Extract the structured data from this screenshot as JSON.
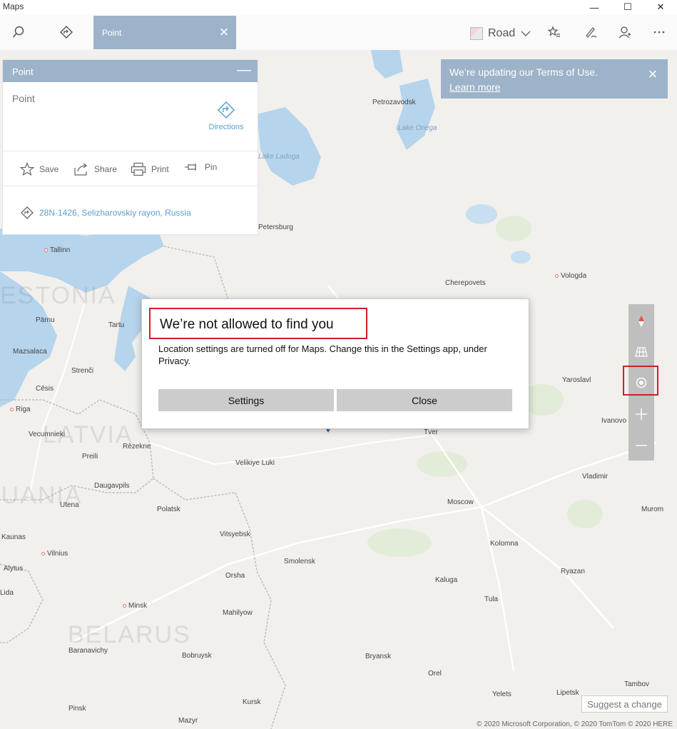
{
  "window": {
    "title": "Maps",
    "minimize": "—",
    "maximize": "☐",
    "close": "✕"
  },
  "toolbar": {
    "search_tab_label": "Point",
    "map_style": "Road"
  },
  "card": {
    "header": "Point",
    "minimize_glyph": "—",
    "name": "Point",
    "directions": "Directions",
    "actions": {
      "save": "Save",
      "share": "Share",
      "print": "Print",
      "pin": "Pin"
    },
    "address": "28N-1426, Selizharovskiy rayon, Russia"
  },
  "terms": {
    "text": "We’re updating our Terms of Use.",
    "link": "Learn more"
  },
  "dialog": {
    "title": "We’re not allowed to find you",
    "body": "Location settings are turned off for Maps. Change this in the Settings app, under Privacy.",
    "settings_button": "Settings",
    "close_button": "Close"
  },
  "footer": {
    "suggest": "Suggest a change",
    "copyright": "© 2020 Microsoft Corporation, © 2020 TomTom © 2020 HERE"
  },
  "map": {
    "cities": [
      "Petrozavodsk",
      "Lake Onega",
      "Lake Ladoga",
      "Petersburg",
      "Tallinn",
      "Cherepovets",
      "Vologda",
      "Tartu",
      "Pärnu",
      "Mazsalaca",
      "Strenči",
      "Cēsis",
      "Riga",
      "Vecumnieki",
      "Rēzekne",
      "Preili",
      "Daugavpils",
      "Utena",
      "Polatsk",
      "Velikiye Luki",
      "Vitsyebsk",
      "Kaunas",
      "Vilnius",
      "Alytus",
      "Orsha",
      "Smolensk",
      "Minsk",
      "Mahilyow",
      "Moscow",
      "Kolomna",
      "Kaluga",
      "Tula",
      "Ryazan",
      "Yaroslavl",
      "Ivanovo",
      "Vladimir",
      "Murom",
      "Tver",
      "Bryansk",
      "Orel",
      "Yelets",
      "Lipetsk",
      "Tambov",
      "Baranavichy",
      "Bobruysk",
      "Pinsk",
      "Mazyr",
      "Kursk",
      "Lida"
    ],
    "countries": [
      "ESTONIA",
      "LATVIA",
      "LITHUANIA",
      "BELARUS"
    ]
  },
  "colors": {
    "accent": "#9db3c9",
    "highlight": "#d01e2a",
    "link": "#5aa0cc"
  }
}
